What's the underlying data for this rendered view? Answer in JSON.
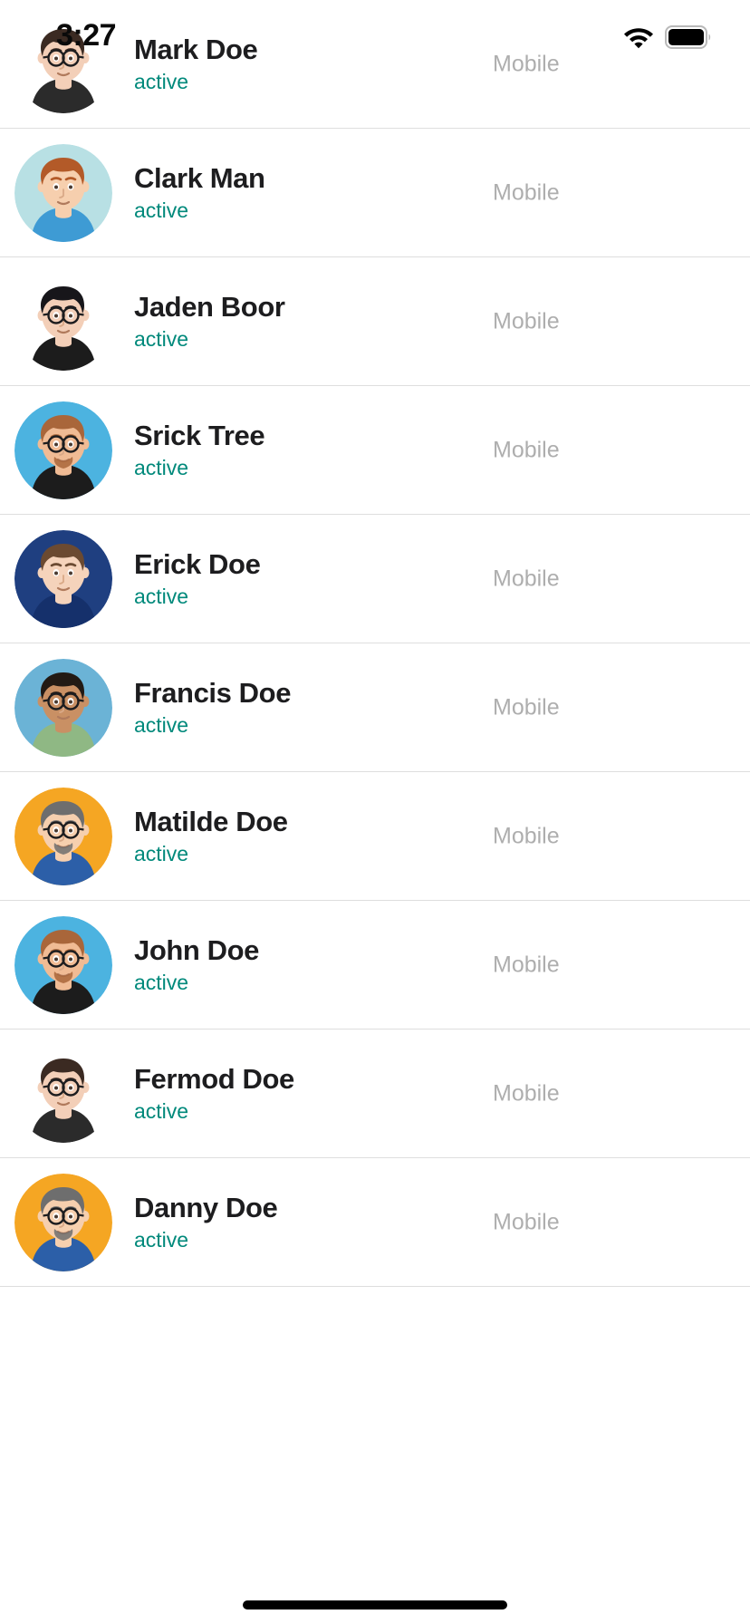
{
  "status_bar": {
    "time": "3:27",
    "wifi_icon": "wifi-icon",
    "battery_icon": "battery-icon"
  },
  "colors": {
    "active_status": "#00897B",
    "name_text": "#1d1d1f",
    "meta_text": "#aeaeae",
    "divider": "#dedede",
    "background": "#ffffff"
  },
  "list": {
    "rows": [
      {
        "name": "Mark Doe",
        "status": "active",
        "meta": "Mobile",
        "avatar": {
          "icon": "avatar-mark-doe",
          "bg": "#ffffff",
          "skin": "#f3cfb8",
          "hair": "#3b2a22",
          "shirt": "#2b2b2b",
          "glasses": true,
          "beard": false
        }
      },
      {
        "name": "Clark Man",
        "status": "active",
        "meta": "Mobile",
        "avatar": {
          "icon": "avatar-clark-man",
          "bg": "#b8e0e4",
          "skin": "#f6cfae",
          "hair": "#b35a28",
          "shirt": "#3e9bd4",
          "glasses": false,
          "beard": false
        }
      },
      {
        "name": "Jaden Boor",
        "status": "active",
        "meta": "Mobile",
        "avatar": {
          "icon": "avatar-jaden-boor",
          "bg": "#ffffff",
          "skin": "#f3cfb8",
          "hair": "#17161a",
          "shirt": "#1c1c1c",
          "glasses": true,
          "beard": false
        }
      },
      {
        "name": "Srick Tree",
        "status": "active",
        "meta": "Mobile",
        "avatar": {
          "icon": "avatar-srick-tree",
          "bg": "#4cb3e0",
          "skin": "#f0bb94",
          "hair": "#a9663a",
          "shirt": "#1c1c1c",
          "glasses": true,
          "beard": true
        }
      },
      {
        "name": "Erick Doe",
        "status": "active",
        "meta": "Mobile",
        "avatar": {
          "icon": "avatar-erick-doe",
          "bg": "#1f3f80",
          "skin": "#f5d3bb",
          "hair": "#6b4a31",
          "shirt": "#15306b",
          "glasses": false,
          "beard": false
        }
      },
      {
        "name": "Francis Doe",
        "status": "active",
        "meta": "Mobile",
        "avatar": {
          "icon": "avatar-francis-doe",
          "bg": "#6bb3d6",
          "skin": "#c99064",
          "hair": "#221a14",
          "shirt": "#8fb884",
          "glasses": true,
          "beard": false
        }
      },
      {
        "name": "Matilde Doe",
        "status": "active",
        "meta": "Mobile",
        "avatar": {
          "icon": "avatar-matilde-doe",
          "bg": "#f5a623",
          "skin": "#f6cfae",
          "hair": "#6e6e6e",
          "shirt": "#2c5fa8",
          "glasses": true,
          "beard": true
        }
      },
      {
        "name": "John Doe",
        "status": "active",
        "meta": "Mobile",
        "avatar": {
          "icon": "avatar-john-doe",
          "bg": "#4cb3e0",
          "skin": "#f0bb94",
          "hair": "#a9663a",
          "shirt": "#1c1c1c",
          "glasses": true,
          "beard": true
        }
      },
      {
        "name": "Fermod Doe",
        "status": "active",
        "meta": "Mobile",
        "avatar": {
          "icon": "avatar-fermod-doe",
          "bg": "#ffffff",
          "skin": "#f3cfb8",
          "hair": "#3b2a22",
          "shirt": "#2b2b2b",
          "glasses": true,
          "beard": false
        }
      },
      {
        "name": "Danny Doe",
        "status": "active",
        "meta": "Mobile",
        "avatar": {
          "icon": "avatar-danny-doe",
          "bg": "#f5a623",
          "skin": "#f6cfae",
          "hair": "#6e6e6e",
          "shirt": "#2c5fa8",
          "glasses": true,
          "beard": true
        }
      }
    ]
  },
  "home_indicator": {
    "label": "home-indicator"
  }
}
